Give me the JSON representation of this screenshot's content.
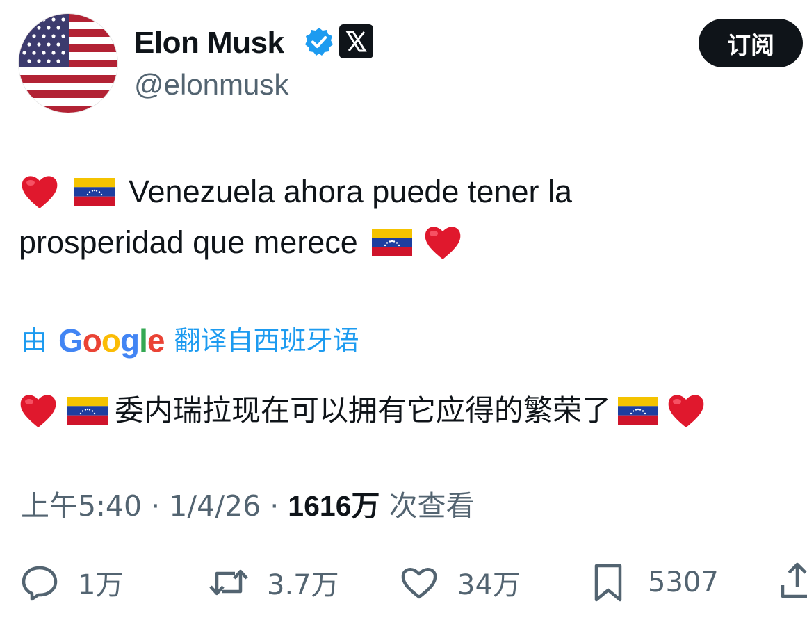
{
  "author": {
    "name": "Elon Musk",
    "handle": "@elonmusk",
    "avatar_icon": "us-flag-avatar",
    "verified_icon": "verified-badge-icon",
    "affiliation_icon": "x-logo-icon"
  },
  "header": {
    "subscribe_label": "订阅"
  },
  "tweet": {
    "line1_text": "Venezuela ahora puede tener la",
    "line2_text": "prosperidad que merece",
    "translation": {
      "prefix": "由",
      "provider": "Google",
      "suffix": "翻译自西班牙语",
      "text": "委内瑞拉现在可以拥有它应得的繁荣了"
    }
  },
  "meta": {
    "time": "上午5:40",
    "date": "1/4/26",
    "views_count": "1616万",
    "views_label": "次查看"
  },
  "actions": {
    "replies": "1万",
    "reposts": "3.7万",
    "likes": "34万",
    "bookmarks": "5307"
  },
  "colors": {
    "accent": "#1d9bf0",
    "text": "#0f1419",
    "muted": "#536471"
  }
}
